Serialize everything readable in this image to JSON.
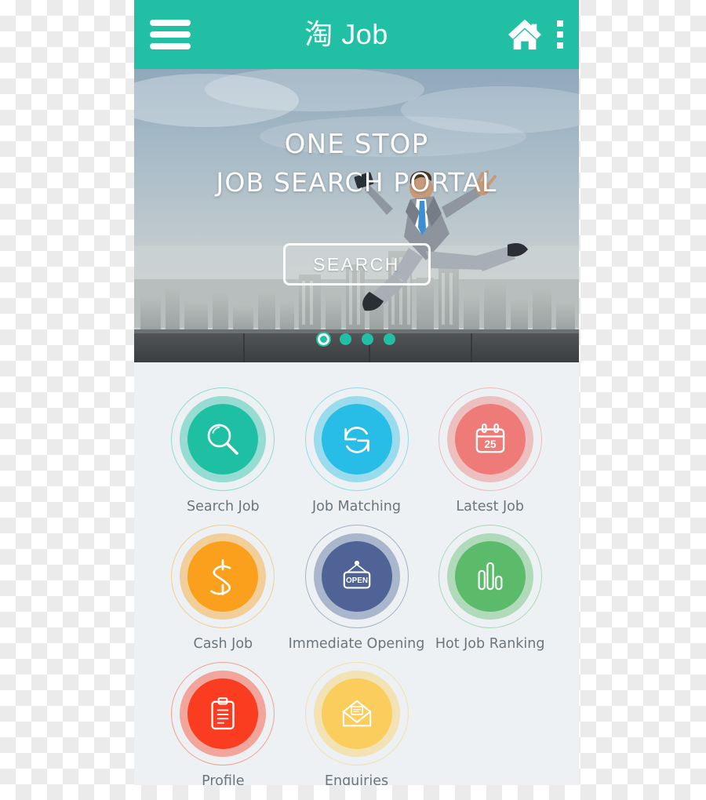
{
  "app": {
    "title": "淘 Job",
    "theme_color": "#21c0a5",
    "page_background": "#edf1f3"
  },
  "header": {
    "menu_icon": "hamburger-menu-icon",
    "title": "淘 Job",
    "home_icon": "home-icon",
    "overflow_icon": "more-vertical-icon"
  },
  "hero": {
    "headline_line1": "ONE STOP",
    "headline_line2": "JOB SEARCH PORTAL",
    "search_button": "SEARCH",
    "carousel": {
      "total": 4,
      "active_index": 0,
      "dot_color": "#21c0a5"
    }
  },
  "grid": {
    "tiles": [
      {
        "label": "Search Job",
        "icon": "magnifier-icon",
        "color": "#1fbfa4"
      },
      {
        "label": "Job Matching",
        "icon": "sync-arrows-icon",
        "color": "#28bde7"
      },
      {
        "label": "Latest Job",
        "icon": "calendar-icon",
        "color": "#ef7b78",
        "icon_text": "25"
      },
      {
        "label": "Cash Job",
        "icon": "dollar-sign-icon",
        "color": "#fba01c"
      },
      {
        "label": "Immediate Opening",
        "icon": "open-sign-icon",
        "color": "#4f6396",
        "icon_text": "OPEN"
      },
      {
        "label": "Hot Job Ranking",
        "icon": "bar-chart-icon",
        "color": "#5cba6b"
      },
      {
        "label": "Profile",
        "icon": "clipboard-icon",
        "color": "#fa3c20"
      },
      {
        "label": "Enquiries",
        "icon": "envelope-open-icon",
        "color": "#fbcd5c"
      }
    ]
  }
}
